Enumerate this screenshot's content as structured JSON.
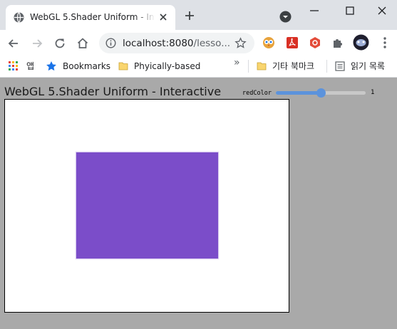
{
  "browser": {
    "tab": {
      "title": "WebGL 5.Shader Uniform - Interactive"
    },
    "address": {
      "host": "localhost:8080",
      "path": "/lesso..."
    },
    "bookmarks": {
      "apps_label": "앱",
      "items": [
        "Bookmarks",
        "Phyically-based"
      ],
      "overflow_label": "»",
      "other_label": "기타 북마크",
      "reading_list_label": "읽기 목록"
    }
  },
  "page": {
    "title": "WebGL 5.Shader Uniform - Interactive",
    "control": {
      "label": "redColor",
      "value": "1",
      "value_fraction": 0.5
    },
    "canvas": {
      "shape_color": "#7b4dc9"
    }
  },
  "colors": {
    "accent": "#5c93dc",
    "tabstrip": "#dee1e6",
    "background": "#a9a9a9"
  }
}
